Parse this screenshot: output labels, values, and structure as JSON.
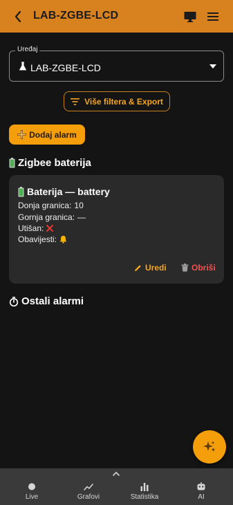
{
  "app_bar": {
    "title": "LAB-ZGBE-LCD",
    "back_icon": "arrow-left-icon",
    "monitor_icon": "monitor-icon",
    "menu_icon": "hamburger-menu-icon",
    "color": "#d7821f"
  },
  "device_select": {
    "label": "Uređaj",
    "value": "LAB-ZGBE-LCD",
    "icon": "flask-icon"
  },
  "filter_button": {
    "label": "Više filtera & Export",
    "icon": "filter-icon"
  },
  "add_alarm_button": {
    "label": "Dodaj alarm",
    "icon": "plus-icon"
  },
  "sections": {
    "zigbee": {
      "title": "Zigbee baterija",
      "icon": "battery-icon"
    },
    "other": {
      "title": "Ostali alarmi",
      "icon": "stopwatch-icon"
    }
  },
  "alarm_card": {
    "title": "Baterija — battery",
    "lower_limit_label": "Donja granica:",
    "lower_limit_value": "10",
    "upper_limit_label": "Gornja granica:",
    "upper_limit_value": "—",
    "muted_label": "Utišan:",
    "muted_icon": "cross-icon",
    "notifications_label": "Obavijesti:",
    "notifications_icon": "bell-icon",
    "edit_label": "Uredi",
    "delete_label": "Obriši"
  },
  "fab": {
    "icon": "sparkle-icon"
  },
  "bottom_nav": {
    "items": [
      {
        "label": "Live",
        "icon": "dot-icon"
      },
      {
        "label": "Grafovi",
        "icon": "trend-line-icon"
      },
      {
        "label": "Statistika",
        "icon": "bar-chart-icon"
      },
      {
        "label": "AI",
        "icon": "robot-icon"
      }
    ]
  },
  "colors": {
    "accent": "#f59e0b",
    "danger": "#ef5350",
    "background": "#141414",
    "card": "#2a2a2a"
  }
}
